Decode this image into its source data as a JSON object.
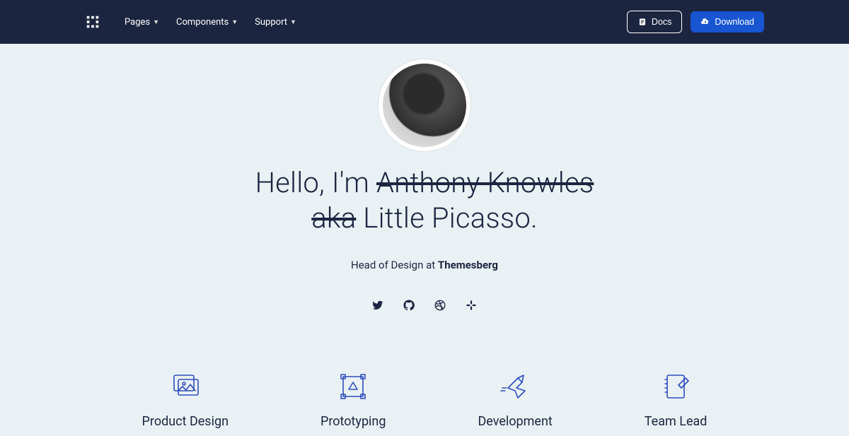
{
  "nav": {
    "links": [
      "Pages",
      "Components",
      "Support"
    ],
    "docs_label": "Docs",
    "download_label": "Download"
  },
  "hero": {
    "greeting_prefix": "Hello, I'm ",
    "strike1": "Anthony Knowles",
    "strike2": "aka",
    "display_name": " Little Picasso.",
    "subtitle_prefix": "Head of Design at ",
    "brand": "Themesberg"
  },
  "social_icons": [
    "twitter-icon",
    "github-icon",
    "dribbble-icon",
    "slack-icon"
  ],
  "skills": [
    {
      "label": "Product Design",
      "icon": "photos-icon"
    },
    {
      "label": "Prototyping",
      "icon": "vector-square-icon"
    },
    {
      "label": "Development",
      "icon": "paper-bird-icon"
    },
    {
      "label": "Team Lead",
      "icon": "notebook-icon"
    }
  ]
}
